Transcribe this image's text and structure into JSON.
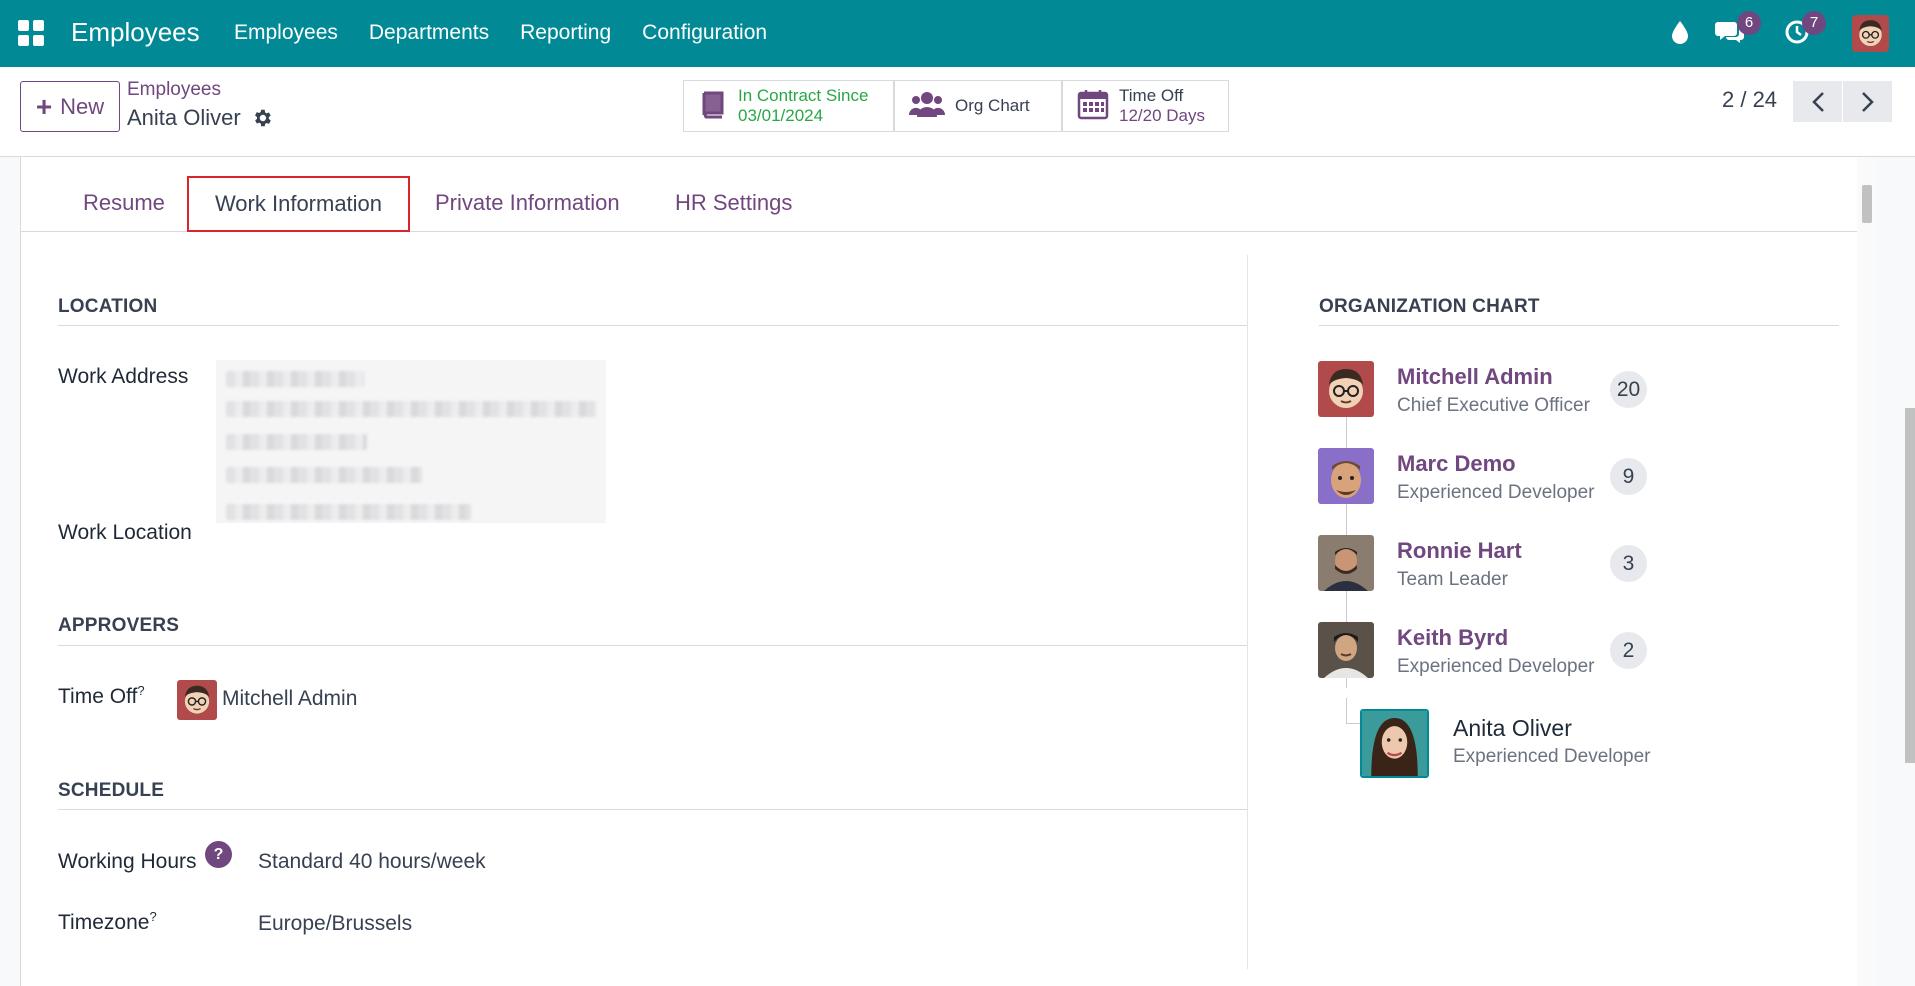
{
  "navbar": {
    "brand": "Employees",
    "menu": [
      "Employees",
      "Departments",
      "Reporting",
      "Configuration"
    ],
    "messages_count": "6",
    "activities_count": "7"
  },
  "control": {
    "new_label": "New",
    "breadcrumb_parent": "Employees",
    "breadcrumb_current": "Anita Oliver",
    "contract_label": "In Contract Since",
    "contract_date": "03/01/2024",
    "org_chart_label": "Org Chart",
    "timeoff_label": "Time Off",
    "timeoff_value": "12/20 Days",
    "pager": "2 / 24"
  },
  "tabs": {
    "resume": "Resume",
    "work_information": "Work Information",
    "private_information": "Private Information",
    "hr_settings": "HR Settings"
  },
  "location": {
    "title": "LOCATION",
    "work_address_label": "Work Address",
    "work_location_label": "Work Location"
  },
  "approvers": {
    "title": "APPROVERS",
    "time_off_label": "Time Off",
    "time_off_approver": "Mitchell Admin"
  },
  "schedule": {
    "title": "SCHEDULE",
    "working_hours_label": "Working Hours",
    "working_hours_value": "Standard 40 hours/week",
    "timezone_label": "Timezone",
    "timezone_value": "Europe/Brussels"
  },
  "org_chart": {
    "title": "ORGANIZATION CHART",
    "managers": [
      {
        "name": "Mitchell Admin",
        "job": "Chief Executive Officer",
        "count": "20"
      },
      {
        "name": "Marc Demo",
        "job": "Experienced Developer",
        "count": "9"
      },
      {
        "name": "Ronnie Hart",
        "job": "Team Leader",
        "count": "3"
      },
      {
        "name": "Keith Byrd",
        "job": "Experienced Developer",
        "count": "2"
      }
    ],
    "self": {
      "name": "Anita Oliver",
      "job": "Experienced Developer"
    }
  },
  "colors": {
    "navbar": "#018a96",
    "accent": "#71477f",
    "highlight_border": "#d9262c",
    "contract_green": "#28a745"
  }
}
